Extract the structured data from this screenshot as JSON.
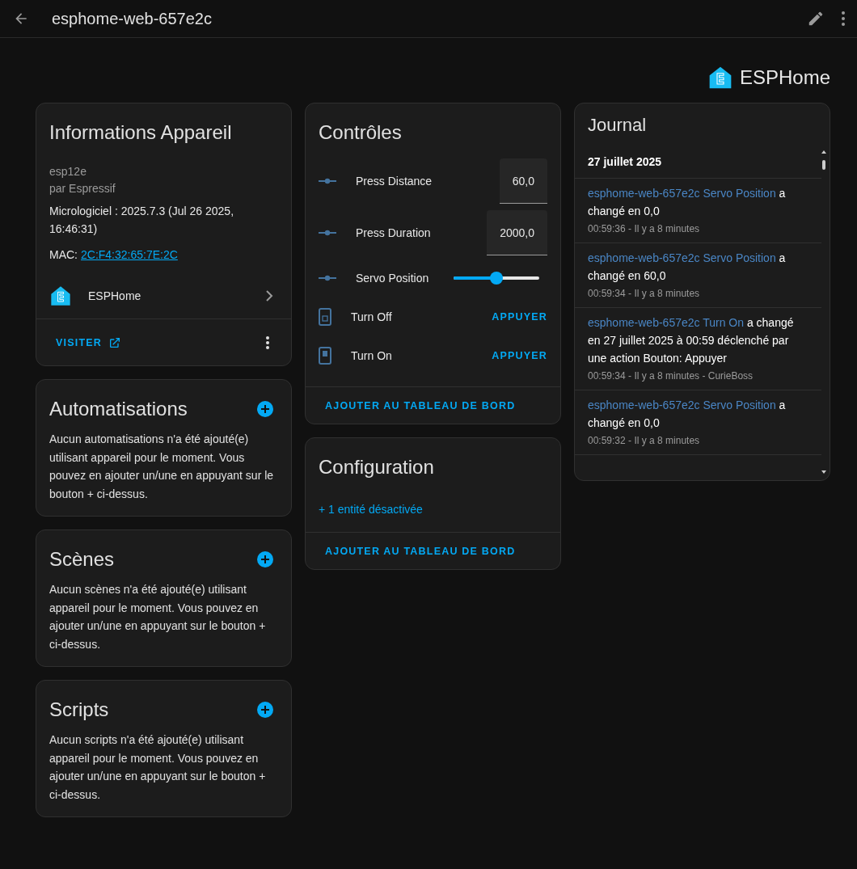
{
  "toolbar": {
    "title": "esphome-web-657e2c"
  },
  "brand": {
    "name": "ESPHome"
  },
  "device_info": {
    "title": "Informations Appareil",
    "model": "esp12e",
    "manufacturer": "par Espressif",
    "firmware": "Micrologiciel : 2025.7.3 (Jul 26 2025, 16:46:31)",
    "mac_label": "MAC:",
    "mac": "2C:F4:32:65:7E:2C",
    "integration": "ESPHome",
    "visit": "VISITER"
  },
  "sections": [
    {
      "title": "Automatisations",
      "text": "Aucun automatisations n'a été ajouté(e) utilisant appareil pour le moment. Vous pouvez en ajouter un/une en appuyant sur le bouton + ci-dessus."
    },
    {
      "title": "Scènes",
      "text": "Aucun scènes n'a été ajouté(e) utilisant appareil pour le moment. Vous pouvez en ajouter un/une en appuyant sur le bouton + ci-dessus."
    },
    {
      "title": "Scripts",
      "text": "Aucun scripts n'a été ajouté(e) utilisant appareil pour le moment. Vous pouvez en ajouter un/une en appuyant sur le bouton + ci-dessus."
    }
  ],
  "controls": {
    "title": "Contrôles",
    "items": [
      {
        "kind": "number",
        "name": "Press Distance",
        "value": "60,0"
      },
      {
        "kind": "number",
        "name": "Press Duration",
        "value": "2000,0"
      },
      {
        "kind": "slider",
        "name": "Servo Position",
        "level": 0.5
      },
      {
        "kind": "button",
        "name": "Turn Off",
        "action": "APPUYER"
      },
      {
        "kind": "button",
        "name": "Turn On",
        "action": "APPUYER"
      }
    ],
    "footer": "AJOUTER AU TABLEAU DE BORD"
  },
  "configuration": {
    "title": "Configuration",
    "link": "+ 1 entité désactivée",
    "footer": "AJOUTER AU TABLEAU DE BORD"
  },
  "journal": {
    "title": "Journal",
    "date": "27 juillet 2025",
    "entries": [
      {
        "entity": "esphome-web-657e2c Servo Position",
        "message": "a changé en 0,0",
        "meta": "00:59:36 - Il y a 8 minutes"
      },
      {
        "entity": "esphome-web-657e2c Servo Position",
        "message": "a changé en 60,0",
        "meta": "00:59:34 - Il y a 8 minutes"
      },
      {
        "entity": "esphome-web-657e2c Turn On",
        "message": "a changé en 27 juillet 2025 à 00:59 déclenché par une action Bouton: Appuyer",
        "meta": "00:59:34 - Il y a 8 minutes - CurieBoss"
      },
      {
        "entity": "esphome-web-657e2c Servo Position",
        "message": "a changé en 0,0",
        "meta": "00:59:32 - Il y a 8 minutes"
      }
    ]
  }
}
